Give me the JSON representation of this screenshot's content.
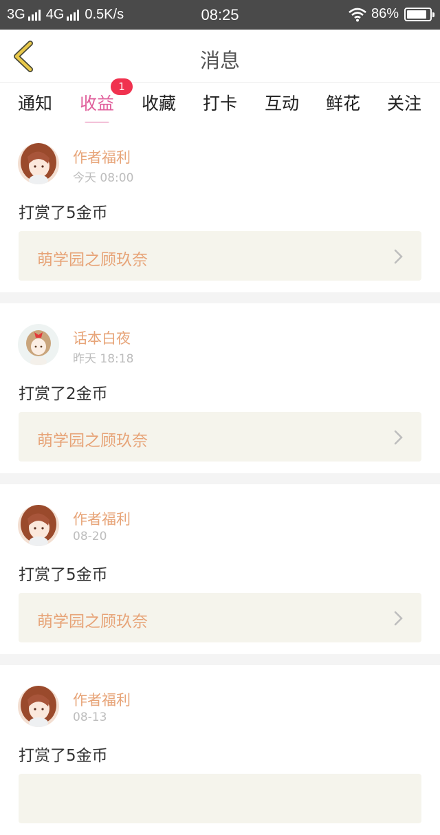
{
  "status_bar": {
    "network_3g": "3G",
    "network_4g": "4G",
    "speed": "0.5K/s",
    "time": "08:25",
    "battery": "86%",
    "battery_level": 0.86
  },
  "header": {
    "title": "消息"
  },
  "tabs": [
    {
      "label": "通知"
    },
    {
      "label": "收益",
      "active": true,
      "badge": "1"
    },
    {
      "label": "收藏"
    },
    {
      "label": "打卡"
    },
    {
      "label": "互动"
    },
    {
      "label": "鲜花"
    },
    {
      "label": "关注"
    }
  ],
  "messages": [
    {
      "sender": "作者福利",
      "time": "今天 08:00",
      "text": "打赏了5金币",
      "work": "萌学园之顾玖奈",
      "avatar_icon": "anime-girl-avatar"
    },
    {
      "sender": "话本白夜",
      "time": "昨天 18:18",
      "text": "打赏了2金币",
      "work": "萌学园之顾玖奈",
      "avatar_icon": "chibi-girl-avatar"
    },
    {
      "sender": "作者福利",
      "time": "08-20",
      "text": "打赏了5金币",
      "work": "萌学园之顾玖奈",
      "avatar_icon": "anime-girl-avatar"
    },
    {
      "sender": "作者福利",
      "time": "08-13",
      "text": "打赏了5金币",
      "work": "",
      "avatar_icon": "anime-girl-avatar"
    }
  ],
  "colors": {
    "accent_pink": "#e0609c",
    "name_orange": "#e7a478",
    "badge_red": "#f0324f",
    "status_bar_bg": "#4a4a4a",
    "back_icon_yellow": "#e8c84a"
  }
}
